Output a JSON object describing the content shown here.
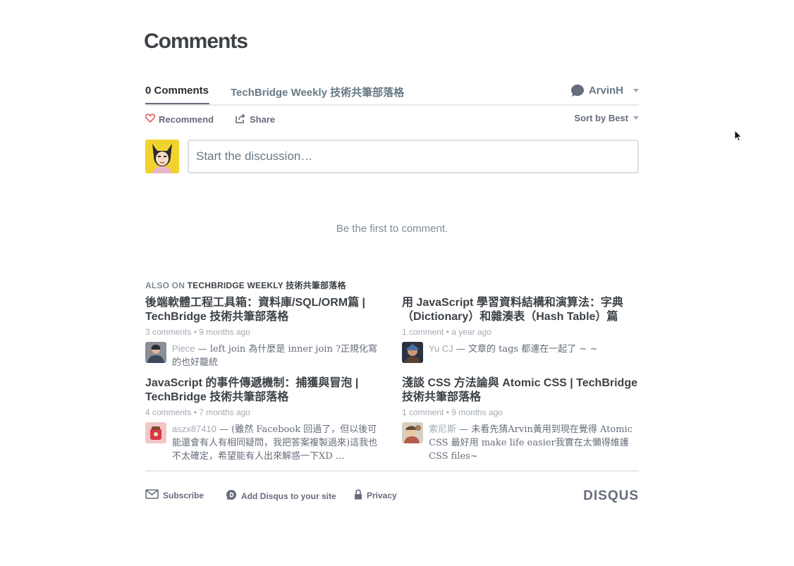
{
  "page": {
    "title": "Comments"
  },
  "tabs": {
    "comments": "0 Comments",
    "community": "TechBridge Weekly 技術共筆部落格"
  },
  "user": {
    "name": "ArvinH"
  },
  "actions": {
    "recommend": "Recommend",
    "share": "Share",
    "sort": "Sort by Best"
  },
  "composer": {
    "placeholder": "Start the discussion…"
  },
  "empty_message": "Be the first to comment.",
  "also_on": {
    "prefix": "ALSO ON",
    "site": "TECHBRIDGE WEEKLY 技術共筆部落格"
  },
  "recommendations": [
    {
      "title": "後端軟體工程工具箱：資料庫/SQL/ORM篇 | TechBridge 技術共筆部落格",
      "comments": "3 comments",
      "age": "9 months ago",
      "author": "Piece",
      "excerpt": "left join 為什麼是 inner join ?正規化寫的也好籠統"
    },
    {
      "title": "用 JavaScript 學習資料結構和演算法：字典（Dictionary）和雜湊表（Hash Table）篇",
      "comments": "1 comment",
      "age": "a year ago",
      "author": "Yu CJ",
      "excerpt": "文章的 tags 都連在一起了 ~ ~"
    },
    {
      "title": "JavaScript 的事件傳遞機制：捕獲與冒泡 | TechBridge 技術共筆部落格",
      "comments": "4 comments",
      "age": "7 months ago",
      "author": "aszx87410",
      "excerpt": "(雖然 Facebook 回過了，但以後可能還會有人有相同疑問，我把答案複製過來)這我也不太確定，希望能有人出來解惑一下XD ..."
    },
    {
      "title": "淺談 CSS 方法論與 Atomic CSS | TechBridge 技術共筆部落格",
      "comments": "1 comment",
      "age": "9 months ago",
      "author": "索尼斯",
      "excerpt": "未看先猜Arvin黃用到現在覺得 Atomic CSS 最好用 make life easier我實在太懶得維護CSS files~"
    }
  ],
  "separator": "—",
  "dot": "•",
  "footer": {
    "subscribe": "Subscribe",
    "add_disqus": "Add Disqus to your site",
    "privacy": "Privacy",
    "brand": "DISQUS"
  },
  "icons": [
    "heart-icon",
    "share-icon",
    "chat-bubble-icon",
    "envelope-icon",
    "disqus-d-icon",
    "lock-icon",
    "cursor-icon"
  ],
  "colors": {
    "heart": "#e2504a",
    "text": "#3d4247",
    "muted": "#a3aab2",
    "avatar_yellow": "#f2d22e"
  }
}
